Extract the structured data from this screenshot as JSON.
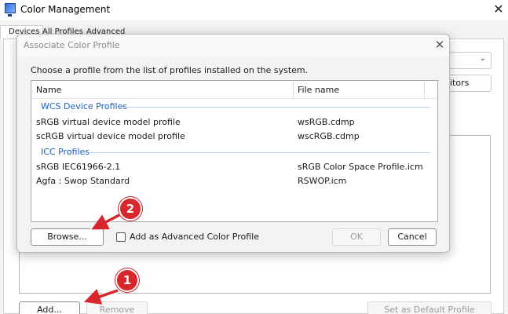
{
  "window": {
    "title": "Color Management",
    "close_glyph": "✕",
    "tabs": [
      {
        "label": "Devices"
      },
      {
        "label": "All Profiles"
      },
      {
        "label": "Advanced"
      }
    ],
    "monitors_button_label": "itors",
    "add_label": "Add...",
    "remove_label": "Remove",
    "set_default_label": "Set as Default Profile"
  },
  "dialog": {
    "title": "Associate Color Profile",
    "close_glyph": "✕",
    "instruction": "Choose a profile from the list of profiles installed on the system.",
    "columns": {
      "name": "Name",
      "file": "File name"
    },
    "groups": [
      {
        "label": "WCS Device Profiles",
        "rows": [
          {
            "name": "sRGB virtual device model profile",
            "file": "wsRGB.cdmp"
          },
          {
            "name": "scRGB virtual device model profile",
            "file": "wscRGB.cdmp"
          }
        ]
      },
      {
        "label": "ICC Profiles",
        "rows": [
          {
            "name": "sRGB IEC61966-2.1",
            "file": "sRGB Color Space Profile.icm"
          },
          {
            "name": "Agfa : Swop Standard",
            "file": "RSWOP.icm"
          }
        ]
      }
    ],
    "browse_label": "Browse...",
    "advanced_checkbox_label": "Add as Advanced Color Profile",
    "advanced_checked": false,
    "ok_label": "OK",
    "cancel_label": "Cancel"
  },
  "annotations": {
    "color": "#d8262c",
    "badges": [
      {
        "number": "1"
      },
      {
        "number": "2"
      }
    ]
  }
}
